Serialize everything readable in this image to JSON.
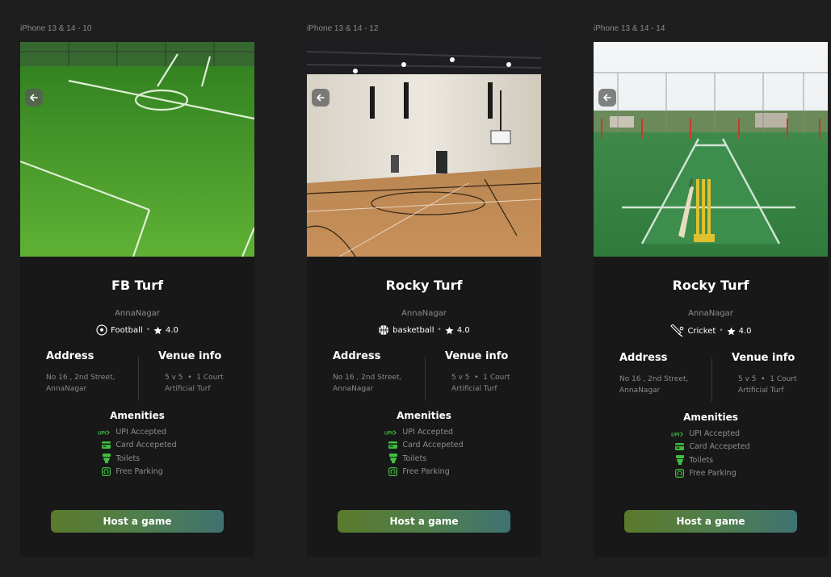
{
  "colors": {
    "canvas": "#1e1e1e",
    "card": "#181818",
    "accent_green": "#3fbf3f",
    "button_start": "#5a7a2b",
    "button_end": "#3f7272"
  },
  "frames": [
    {
      "frame_label": "iPhone 13 & 14 - 10",
      "hero": "football-turf-photo",
      "title": "FB Turf",
      "location": "AnnaNagar",
      "sport_icon": "football-icon",
      "sport": "Football",
      "rating": "4.0",
      "address_heading": "Address",
      "address_line1": "No 16 , 2nd Street,",
      "address_line2": "AnnaNagar",
      "venue_heading": "Venue info",
      "venue_line1": "5 v 5  •  1 Court",
      "venue_line2": "Artificial Turf",
      "amenities_heading": "Amenities",
      "amenities": [
        "UPI Accepted",
        "Card Accepeted",
        "Toilets",
        "Free Parking"
      ],
      "cta": "Host a game"
    },
    {
      "frame_label": "iPhone 13 & 14 - 12",
      "hero": "basketball-court-photo",
      "title": "Rocky Turf",
      "location": "AnnaNagar",
      "sport_icon": "basketball-icon",
      "sport": "basketball",
      "rating": "4.0",
      "address_heading": "Address",
      "address_line1": "No 16 , 2nd Street,",
      "address_line2": "AnnaNagar",
      "venue_heading": "Venue info",
      "venue_line1": "5 v 5  •  1 Court",
      "venue_line2": "Artificial Turf",
      "amenities_heading": "Amenities",
      "amenities": [
        "UPI Accepted",
        "Card Accepeted",
        "Toilets",
        "Free Parking"
      ],
      "cta": "Host a game"
    },
    {
      "frame_label": "iPhone 13 & 14 - 14",
      "hero": "cricket-pitch-photo",
      "title": "Rocky Turf",
      "location": "AnnaNagar",
      "sport_icon": "cricket-icon",
      "sport": "Cricket",
      "rating": "4.0",
      "address_heading": "Address",
      "address_line1": "No 16 , 2nd Street,",
      "address_line2": "AnnaNagar",
      "venue_heading": "Venue info",
      "venue_line1": "5 v 5  •  1 Court",
      "venue_line2": "Artificial Turf",
      "amenities_heading": "Amenities",
      "amenities": [
        "UPI Accepted",
        "Card Accepeted",
        "Toilets",
        "Free Parking"
      ],
      "cta": "Host a game"
    }
  ],
  "amenity_icons": [
    "upi-icon",
    "card-icon",
    "toilet-icon",
    "parking-icon"
  ],
  "upi_glyph": "UPI"
}
